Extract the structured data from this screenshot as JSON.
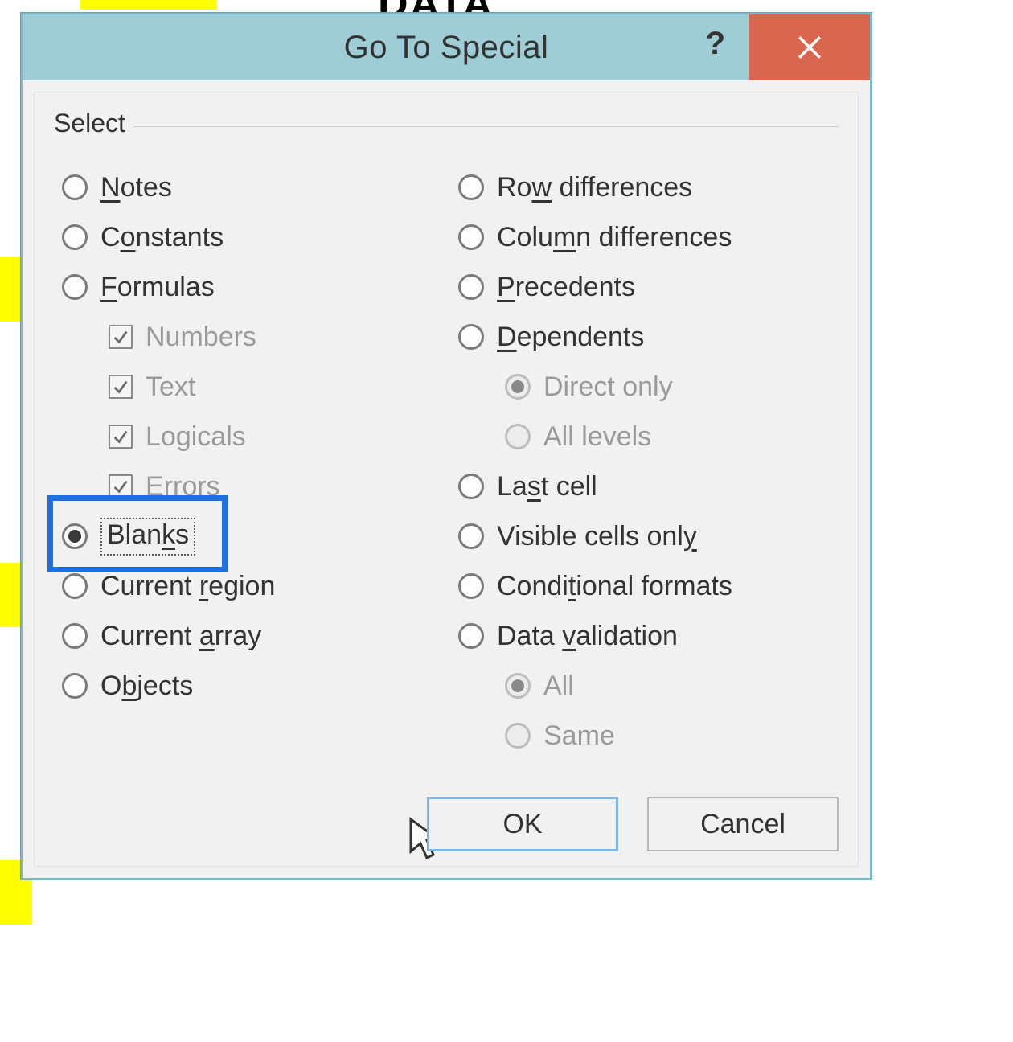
{
  "background": {
    "data_label": "DATA"
  },
  "dialog": {
    "title": "Go To Special",
    "help_symbol": "?",
    "group_label": "Select",
    "left_options": [
      {
        "id": "notes",
        "pre": "",
        "u": "N",
        "post": "otes",
        "selected": false
      },
      {
        "id": "constants",
        "pre": "C",
        "u": "o",
        "post": "nstants",
        "selected": false
      },
      {
        "id": "formulas",
        "pre": "",
        "u": "F",
        "post": "ormulas",
        "selected": false
      },
      {
        "id": "blanks",
        "pre": "Blan",
        "u": "k",
        "post": "s",
        "selected": true,
        "focused": true
      },
      {
        "id": "current-region",
        "pre": "Current ",
        "u": "r",
        "post": "egion",
        "selected": false
      },
      {
        "id": "current-array",
        "pre": "Current ",
        "u": "a",
        "post": "rray",
        "selected": false
      },
      {
        "id": "objects",
        "pre": "O",
        "u": "b",
        "post": "jects",
        "selected": false
      }
    ],
    "formula_subs": [
      {
        "id": "numbers",
        "label": "Numbers",
        "checked": true
      },
      {
        "id": "text",
        "label": "Text",
        "checked": true
      },
      {
        "id": "logicals",
        "label": "Logicals",
        "checked": true
      },
      {
        "id": "errors",
        "label": "Errors",
        "checked": true
      }
    ],
    "right_options": [
      {
        "id": "row-diff",
        "pre": "Ro",
        "u": "w",
        "post": " differences",
        "selected": false
      },
      {
        "id": "col-diff",
        "pre": "Colu",
        "u": "m",
        "post": "n differences",
        "selected": false
      },
      {
        "id": "precedents",
        "pre": "",
        "u": "P",
        "post": "recedents",
        "selected": false
      },
      {
        "id": "dependents",
        "pre": "",
        "u": "D",
        "post": "ependents",
        "selected": false
      },
      {
        "id": "last-cell",
        "pre": "La",
        "u": "s",
        "post": "t cell",
        "selected": false
      },
      {
        "id": "visible",
        "pre": "Visible cells onl",
        "u": "y",
        "post": "",
        "selected": false
      },
      {
        "id": "cond-fmt",
        "pre": "Condi",
        "u": "t",
        "post": "ional formats",
        "selected": false
      },
      {
        "id": "data-val",
        "pre": "Data ",
        "u": "v",
        "post": "alidation",
        "selected": false
      }
    ],
    "dep_subs": [
      {
        "id": "direct",
        "label": "Direct only",
        "selected": true,
        "disabled": true
      },
      {
        "id": "levels",
        "label": "All levels",
        "selected": false,
        "disabled": true
      }
    ],
    "val_subs": [
      {
        "id": "all",
        "label": "All",
        "selected": true,
        "disabled": true
      },
      {
        "id": "same",
        "label": "Same",
        "selected": false,
        "disabled": true
      }
    ],
    "buttons": {
      "ok": "OK",
      "cancel": "Cancel"
    }
  },
  "highlight": {
    "target": "blanks"
  }
}
